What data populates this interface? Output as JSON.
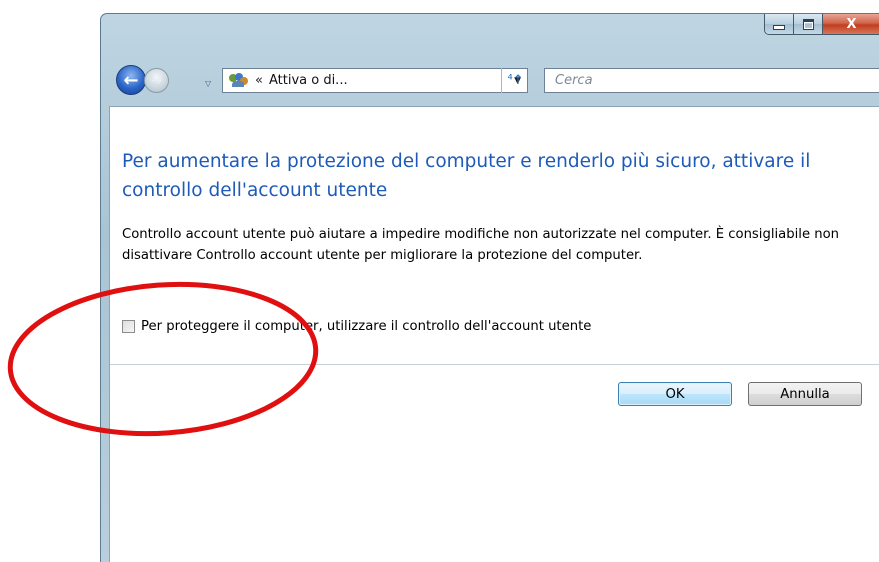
{
  "window": {
    "close_glyph": "X"
  },
  "nav": {
    "back_glyph": "←",
    "forward_glyph": "→",
    "history_glyph": "▽",
    "address_sep": "«",
    "address_text": "Attiva o di...",
    "address_dropdown": "▼",
    "refresh_glyph": "⁴↑",
    "search_placeholder": "Cerca"
  },
  "dialog": {
    "heading": "Per aumentare la protezione del computer e renderlo più sicuro, attivare il controllo dell'account utente",
    "description": "Controllo account utente può aiutare a impedire modifiche non autorizzate nel computer. È consigliabile non disattivare Controllo account utente per migliorare la protezione del computer.",
    "checkbox_label": "Per proteggere il computer, utilizzare il controllo dell'account utente",
    "checkbox_checked": false,
    "ok_label": "OK",
    "cancel_label": "Annulla"
  },
  "annotation": {
    "shape": "ellipse",
    "color": "#e01010"
  },
  "colors": {
    "heading": "#1e5bb8",
    "annotation": "#e01010",
    "ok_border": "#3c7fb1"
  }
}
